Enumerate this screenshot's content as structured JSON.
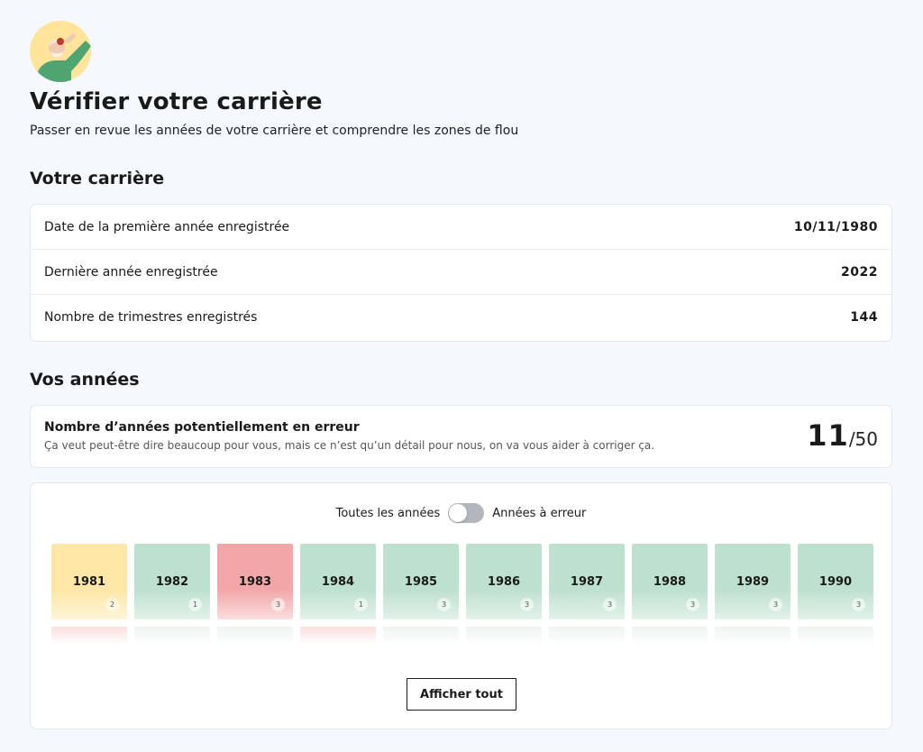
{
  "header": {
    "title": "Vérifier votre carrière",
    "subtitle": "Passer en revue les années de votre carrière et comprendre les zones de flou"
  },
  "career": {
    "section_title": "Votre carrière",
    "rows": [
      {
        "label": "Date de la première année enregistrée",
        "value": "10/11/1980"
      },
      {
        "label": "Dernière année enregistrée",
        "value": "2022"
      },
      {
        "label": "Nombre de trimestres enregistrés",
        "value": "144"
      }
    ]
  },
  "years": {
    "section_title": "Vos années",
    "error_card": {
      "title": "Nombre d’années potentiellement en erreur",
      "description": "Ça veut peut-être dire beaucoup pour vous, mais ce n’est qu’un détail pour nous, on va vous aider à corriger ça.",
      "count": "11",
      "total": "/50"
    },
    "filter": {
      "left_label": "Toutes les années",
      "right_label": "Années à erreur"
    },
    "tiles": [
      {
        "year": "1981",
        "quarters": "2",
        "status": "warn"
      },
      {
        "year": "1982",
        "quarters": "1",
        "status": "ok"
      },
      {
        "year": "1983",
        "quarters": "3",
        "status": "error"
      },
      {
        "year": "1984",
        "quarters": "1",
        "status": "ok"
      },
      {
        "year": "1985",
        "quarters": "3",
        "status": "ok"
      },
      {
        "year": "1986",
        "quarters": "3",
        "status": "ok"
      },
      {
        "year": "1987",
        "quarters": "3",
        "status": "ok"
      },
      {
        "year": "1988",
        "quarters": "3",
        "status": "ok"
      },
      {
        "year": "1989",
        "quarters": "3",
        "status": "ok"
      },
      {
        "year": "1990",
        "quarters": "3",
        "status": "ok"
      }
    ],
    "show_all_label": "Afficher tout"
  },
  "colors": {
    "ok": "#bee0cf",
    "warn": "#fde6a6",
    "error": "#f1a6a7",
    "avatar_bg": "#ffe49a"
  }
}
